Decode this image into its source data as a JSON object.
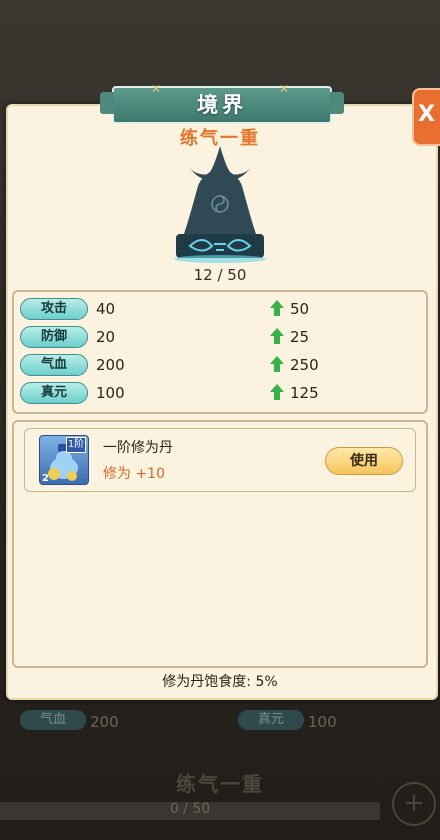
{
  "dialog": {
    "title": "境界",
    "realm_name": "练气一重",
    "progress_text": "12 / 50",
    "close_label": "X"
  },
  "stats": [
    {
      "label": "攻击",
      "value": "40",
      "next": "50"
    },
    {
      "label": "防御",
      "value": "20",
      "next": "25"
    },
    {
      "label": "气血",
      "value": "200",
      "next": "250"
    },
    {
      "label": "真元",
      "value": "100",
      "next": "125"
    }
  ],
  "item": {
    "name": "一阶修为丹",
    "effect": "修为 +10",
    "badge": "1阶",
    "count": "2",
    "button_label": "使用"
  },
  "footer": {
    "satiety_text": "修为丹饱食度: 5%"
  },
  "background": {
    "stat_left_label": "气血",
    "stat_left_value": "200",
    "stat_right_label": "真元",
    "stat_right_value": "100",
    "realm_name": "练气一重",
    "progress_text": "0 / 50",
    "plus_icon": "+"
  },
  "colors": {
    "accent_orange": "#e6762a",
    "panel_bg": "#fbf3df",
    "pill_teal": "#6ccfcb",
    "arrow_green": "#35b24a"
  },
  "icons": [
    "close-icon",
    "up-arrow-icon",
    "pill-gourd-icon",
    "plus-icon"
  ]
}
